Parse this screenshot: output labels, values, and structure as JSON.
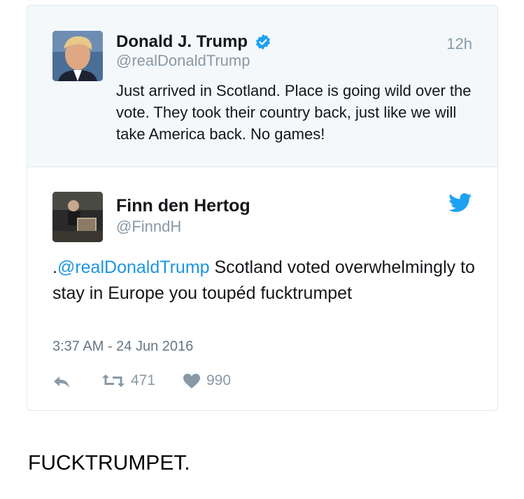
{
  "quoted_tweet": {
    "author_name": "Donald J. Trump",
    "handle": "@realDonaldTrump",
    "time": "12h",
    "text": "Just arrived in Scotland. Place is going wild over the vote. They took their country back, just like we will take America back. No games!",
    "verified": true,
    "avatar_icon": "profile-photo"
  },
  "reply_tweet": {
    "author_name": "Finn den Hertog",
    "handle": "@FinndH",
    "text_prefix": ".",
    "mention": "@realDonaldTrump",
    "text_body": " Scotland voted overwhelmingly to stay in Europe you toupéd fucktrumpet",
    "timestamp": "3:37 AM - 24 Jun 2016",
    "retweets": "471",
    "likes": "990",
    "platform_icon": "twitter-bird-icon"
  },
  "caption": "FUCKTRUMPET.",
  "colors": {
    "link_blue": "#1b95e0",
    "muted_gray": "#8899a6",
    "quoted_bg": "#f5f8fa",
    "border": "#e1e8ed"
  }
}
